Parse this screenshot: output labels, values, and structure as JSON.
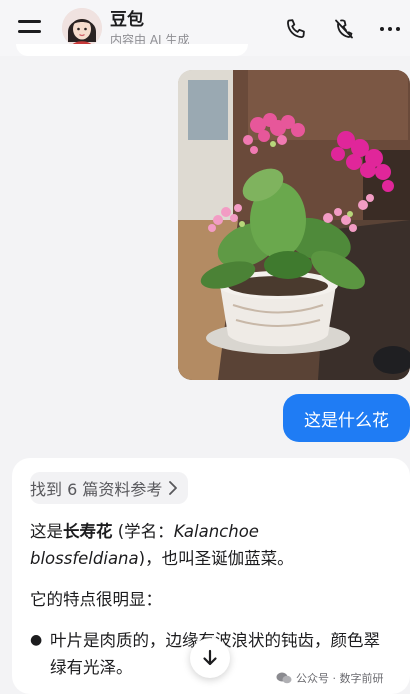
{
  "header": {
    "title": "豆包",
    "subtitle": "内容由 AI 生成",
    "icons": [
      "menu-icon",
      "avatar",
      "phone-icon",
      "mute-icon",
      "more-icon"
    ]
  },
  "messages": {
    "user_image": {
      "type": "photo",
      "subject": "potted kalanchoe"
    },
    "user_text": "这是什么花"
  },
  "answer": {
    "refs_label": "找到 6 篇资料参考",
    "p1_prefix": "这是",
    "p1_name": "长寿花",
    "p1_mid": " (学名：",
    "p1_latin": "Kalanchoe blossfeldiana",
    "p1_suffix": ")，也叫圣诞伽蓝菜。",
    "p2": "它的特点很明显：",
    "bullet1": "叶片是肉质的，边缘有波浪状的钝齿，颜色翠绿有光泽。"
  },
  "watermark": "公众号 · 数字前研",
  "colors": {
    "accent": "#1f7cf4",
    "background": "#f3f3f5"
  }
}
